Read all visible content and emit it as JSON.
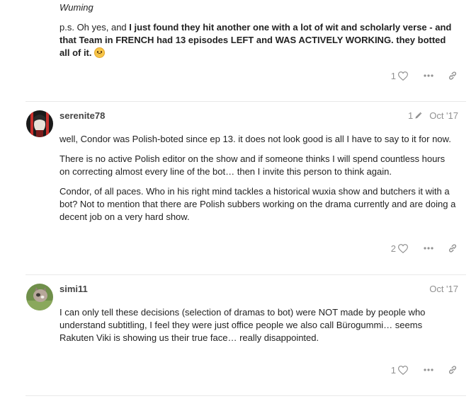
{
  "previous_post": {
    "quote_attribution": "Wuming",
    "ps_prefix": "p.s. Oh yes, and ",
    "ps_bold": "I just found they hit another one with a lot of wit and scholarly verse - and that Team in FRENCH had 13 episodes LEFT and WAS ACTIVELY WORKING. they botted all of it.",
    "emoji": "frowning-face",
    "likes": "1"
  },
  "posts": [
    {
      "username": "serenite78",
      "edit_count": "1",
      "date": "Oct '17",
      "paragraphs": [
        "well, Condor was Polish-boted since ep 13. it does not look good is all I have to say to it for now.",
        "There is no active Polish editor on the show and if someone thinks I will spend countless hours on correcting almost every line of the bot… then I invite this person to think again.",
        "Condor, of all paces. Who in his right mind tackles a historical wuxia show and butchers it with a bot? Not to mention that there are Polish subbers working on the drama currently and are doing a decent job on a very hard show."
      ],
      "likes": "2"
    },
    {
      "username": "simi11",
      "date": "Oct '17",
      "paragraphs": [
        "I can only tell these decisions (selection of dramas to bot) were NOT made by people who understand subtitling, I feel they were just office people we also call Bürogummi… seems Rakuten Viki is showing us their true face… really disappointed."
      ],
      "likes": "1"
    }
  ],
  "colors": {
    "muted": "#919191",
    "divider": "#e9e9e9",
    "text": "#222222"
  }
}
